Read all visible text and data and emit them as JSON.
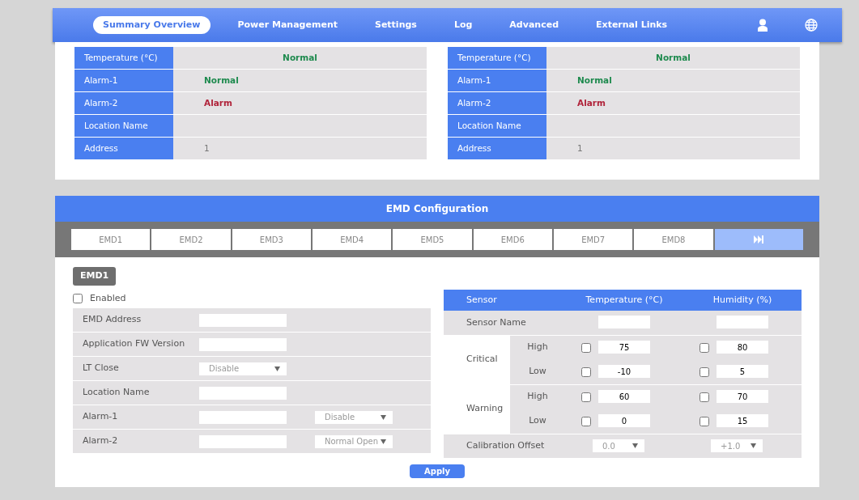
{
  "nav": {
    "items": [
      {
        "label": "Summary Overview",
        "selected": true
      },
      {
        "label": "Power Management",
        "selected": false
      },
      {
        "label": "Settings",
        "selected": false
      },
      {
        "label": "Log",
        "selected": false
      },
      {
        "label": "Advanced",
        "selected": false
      },
      {
        "label": "External Links",
        "selected": false
      }
    ]
  },
  "sensor_panels": [
    {
      "rows": [
        {
          "label": "Temperature (°C)",
          "value": "Normal",
          "color": "#1e8a4e"
        },
        {
          "label": "Alarm-1",
          "value": "Normal",
          "color": "#1e8a4e"
        },
        {
          "label": "Alarm-2",
          "value": "Alarm",
          "color": "#b0233a"
        },
        {
          "label": "Location Name"
        },
        {
          "label": "Address",
          "value": "1"
        }
      ]
    },
    {
      "rows": [
        {
          "label": "Temperature (°C)",
          "value": "Normal",
          "color": "#1e8a4e"
        },
        {
          "label": "Alarm-1",
          "value": "Normal",
          "color": "#1e8a4e"
        },
        {
          "label": "Alarm-2",
          "value": "Alarm",
          "color": "#b0233a"
        },
        {
          "label": "Location Name"
        },
        {
          "label": "Address",
          "value": "1"
        }
      ]
    }
  ],
  "emd": {
    "title": "EMD Configuration",
    "tabs": [
      {
        "label": "EMD1",
        "selected": false
      },
      {
        "label": "EMD2",
        "selected": false
      },
      {
        "label": "EMD3",
        "selected": false
      },
      {
        "label": "EMD4",
        "selected": false
      },
      {
        "label": "EMD5",
        "selected": false
      },
      {
        "label": "EMD6",
        "selected": false
      },
      {
        "label": "EMD7",
        "selected": false
      },
      {
        "label": "EMD8",
        "selected": false
      }
    ],
    "section_label": "EMD1",
    "enabled": {
      "label": "Enabled",
      "checked": false
    },
    "fields": [
      {
        "label": "EMD Address",
        "kind": "text"
      },
      {
        "label": "Application FW Version",
        "kind": "text"
      },
      {
        "label": "LT Close",
        "kind": "select",
        "value": "Disable"
      },
      {
        "label": "Location Name",
        "kind": "text"
      },
      {
        "label": "Alarm-1",
        "kind": "text_select",
        "value": "Disable"
      },
      {
        "label": "Alarm-2",
        "kind": "text_select",
        "value": "Normal Open"
      }
    ],
    "sensor_table": {
      "columns": [
        "Sensor",
        "Temperature (°C)",
        "Humidity (%)"
      ],
      "name_row": {
        "label": "Sensor Name"
      },
      "groups": [
        {
          "label": "Critical",
          "levels": [
            {
              "label": "High",
              "temperature": {
                "checked": false,
                "value": "75"
              },
              "humidity": {
                "checked": false,
                "value": "80"
              }
            },
            {
              "label": "Low",
              "temperature": {
                "checked": false,
                "value": "-10"
              },
              "humidity": {
                "checked": false,
                "value": "5"
              }
            }
          ]
        },
        {
          "label": "Warning",
          "levels": [
            {
              "label": "High",
              "temperature": {
                "checked": false,
                "value": "60"
              },
              "humidity": {
                "checked": false,
                "value": "70"
              }
            },
            {
              "label": "Low",
              "temperature": {
                "checked": false,
                "value": "0"
              },
              "humidity": {
                "checked": false,
                "value": "15"
              }
            }
          ]
        }
      ],
      "calibration": {
        "label": "Calibration Offset",
        "temperature": "0.0",
        "humidity": "+1.0"
      }
    },
    "apply": "Apply"
  }
}
